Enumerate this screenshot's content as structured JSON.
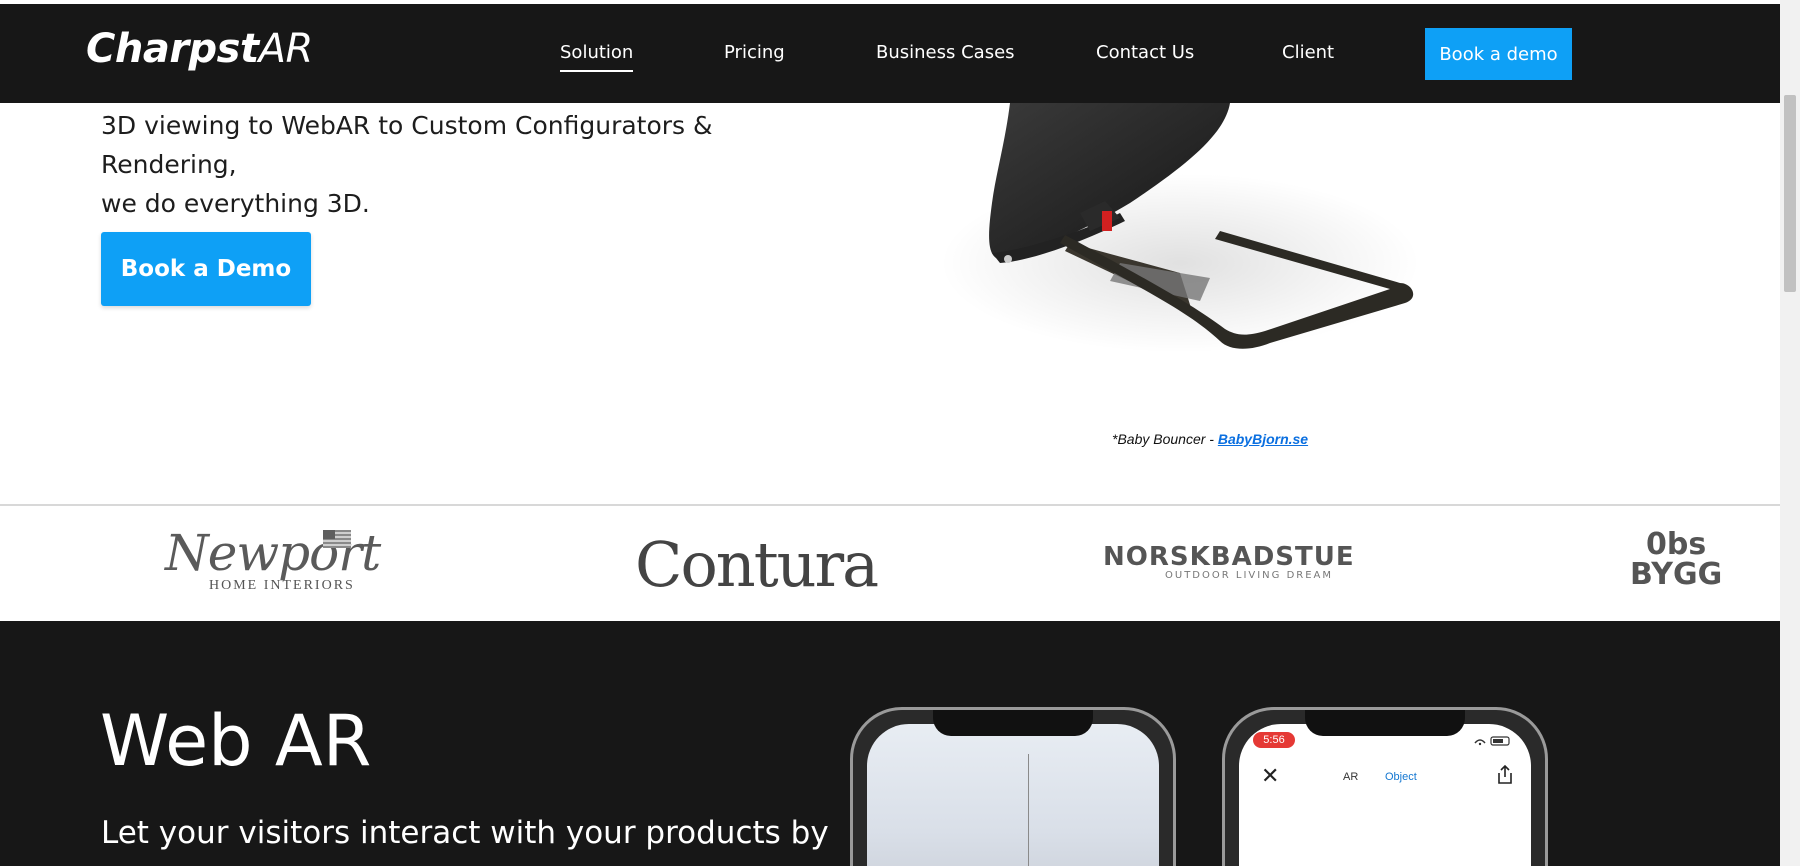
{
  "header": {
    "logo_bold": "Charpst",
    "logo_thin": "AR",
    "nav": [
      {
        "label": "Solution"
      },
      {
        "label": "Pricing"
      },
      {
        "label": "Business Cases"
      },
      {
        "label": "Contact Us"
      },
      {
        "label": "Client"
      }
    ],
    "cta_label": "Book a demo"
  },
  "hero": {
    "line1": "3D viewing to WebAR to Custom Configurators & Rendering,",
    "line2": "we do everything 3D.",
    "button_label": "Book a Demo",
    "caption_prefix": "*Baby Bouncer - ",
    "caption_link": "BabyBjorn.se"
  },
  "brands": {
    "newport_name": "Newport",
    "newport_sub": "HOME INTERIORS",
    "contura": "Contura",
    "norsk_name": "NORSKBADSTUE",
    "norsk_sub": "OUTDOOR LIVING DREAM",
    "obs_line1": "0bs",
    "obs_line2": "BYGG"
  },
  "webar": {
    "title": "Web AR",
    "text": "Let your visitors interact with your products by",
    "phone2_time": "5:56",
    "phone2_mode_ar": "AR",
    "phone2_mode_object": "Object"
  },
  "colors": {
    "accent": "#0ea0f6",
    "header_bg": "#171717",
    "link": "#0a6fe0"
  }
}
